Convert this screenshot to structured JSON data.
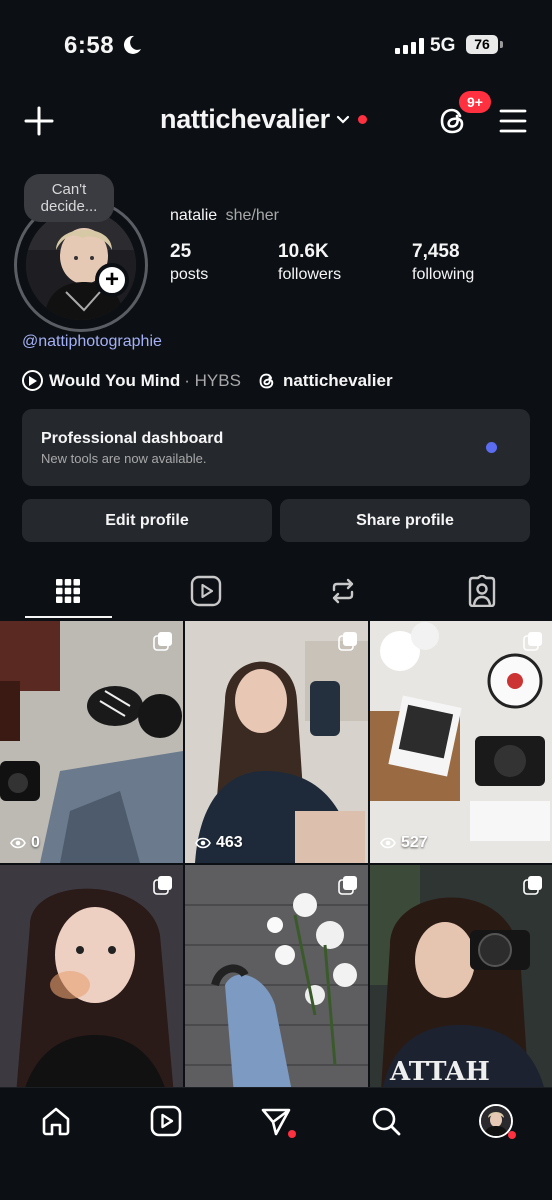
{
  "status": {
    "time": "6:58",
    "network": "5G",
    "battery": "76"
  },
  "nav": {
    "username": "nattichevalier",
    "notification_badge": "9+"
  },
  "profile": {
    "note": "Can't decide...",
    "name": "natalie",
    "pronouns": "she/her",
    "stats": [
      {
        "value": "25",
        "label": "posts"
      },
      {
        "value": "10.6K",
        "label": "followers"
      },
      {
        "value": "7,458",
        "label": "following"
      }
    ],
    "link": "@nattiphotographie",
    "music": {
      "song": "Would You Mind",
      "artist": "· HYBS"
    },
    "threads_handle": "nattichevalier"
  },
  "dashboard": {
    "title": "Professional dashboard",
    "subtitle": "New tools are now available."
  },
  "buttons": {
    "edit": "Edit profile",
    "share": "Share profile"
  },
  "tabs": [
    {
      "name": "grid",
      "icon": "grid-icon",
      "active": true
    },
    {
      "name": "reels",
      "icon": "reels-icon",
      "active": false
    },
    {
      "name": "reposts",
      "icon": "repost-icon",
      "active": false
    },
    {
      "name": "tagged",
      "icon": "tagged-icon",
      "active": false
    }
  ],
  "posts": [
    {
      "views": "0"
    },
    {
      "views": "463"
    },
    {
      "views": "527"
    },
    {
      "views": ""
    },
    {
      "views": ""
    },
    {
      "views": ""
    }
  ],
  "bottom_nav": [
    "home-icon",
    "reels-icon",
    "messages-icon",
    "search-icon",
    "profile-avatar"
  ],
  "colors": {
    "background": "#0c1014",
    "accent_red": "#ff3040",
    "link": "#a4b0f5",
    "card": "#25292e",
    "dashboard_dot": "#5b6cf0"
  }
}
